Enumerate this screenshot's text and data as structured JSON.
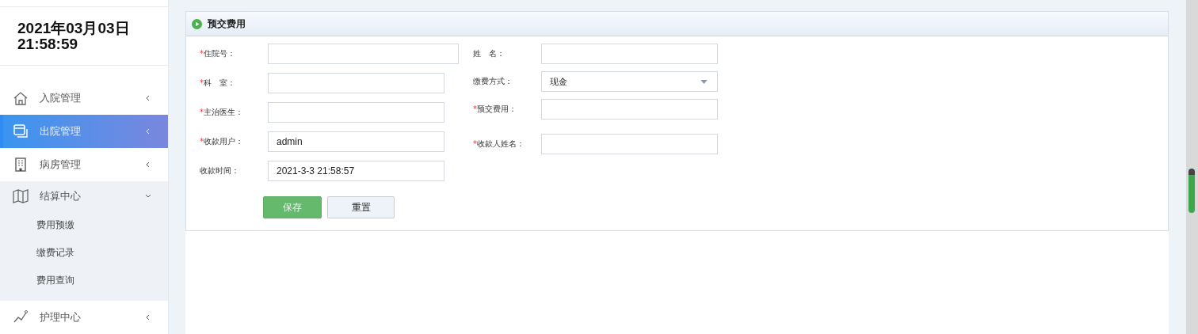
{
  "clock": {
    "date": "2021年03月03日",
    "time": "21:58:59"
  },
  "sidebar": {
    "items": [
      {
        "label": "入院管理",
        "selected": false,
        "expanded": false
      },
      {
        "label": "出院管理",
        "selected": true,
        "expanded": false
      },
      {
        "label": "病房管理",
        "selected": false,
        "expanded": false
      },
      {
        "label": "结算中心",
        "selected": false,
        "expanded": true,
        "children": [
          {
            "label": "费用预缴"
          },
          {
            "label": "缴费记录"
          },
          {
            "label": "费用查询"
          }
        ]
      },
      {
        "label": "护理中心",
        "selected": false,
        "expanded": false
      }
    ]
  },
  "panel": {
    "title": "预交费用",
    "left_fields": [
      {
        "label": "住院号：",
        "required_mark": "*",
        "kind": "input",
        "wide": true
      },
      {
        "label": "科　室：",
        "required_mark": "*",
        "kind": "input"
      },
      {
        "label": "主治医生：",
        "required_mark": "*",
        "kind": "input"
      },
      {
        "label": "收款用户：",
        "required_mark": "*",
        "kind": "input",
        "value": "admin"
      },
      {
        "label": "收款时间：",
        "kind": "input",
        "value": "2021-3-3 21:58:57"
      }
    ],
    "right_fields": [
      {
        "label": "姓　名：",
        "kind": "input"
      },
      {
        "label": "缴费方式：",
        "kind": "select",
        "value": "现金"
      },
      {
        "label": "预交费用：",
        "required_mark": "*",
        "kind": "input"
      },
      {
        "label": "收款人姓名：",
        "required_mark": "*",
        "kind": "input"
      }
    ],
    "buttons": [
      {
        "label": "保存",
        "kind": "primary"
      },
      {
        "label": "重置",
        "kind": "default"
      }
    ]
  }
}
